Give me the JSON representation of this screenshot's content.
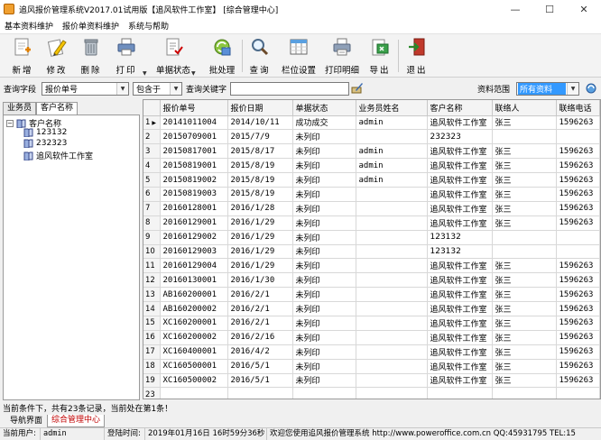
{
  "window": {
    "title": "追风报价管理系统V2017.01试用版【追风软件工作室】 [综合管理中心]",
    "min_label": "—",
    "max_label": "☐",
    "close_label": "✕"
  },
  "menu": [
    "基本资料维护",
    "报价单资料维护",
    "系统与帮助"
  ],
  "toolbar": {
    "new": "新增",
    "edit": "修改",
    "delete": "删除",
    "print": "打印",
    "status": "单据状态",
    "batch": "批处理",
    "query": "查询",
    "columns": "栏位设置",
    "print_detail": "打印明细",
    "export": "导出",
    "exit": "退出"
  },
  "query": {
    "field_label": "查询字段",
    "field_value": "报价单号",
    "op_value": "包含于",
    "keyword_label": "查询关键字",
    "keyword_value": "",
    "scope_label": "资料范围",
    "scope_value": "所有资料"
  },
  "left_tabs": [
    "业务员",
    "客户名称"
  ],
  "tree": {
    "root": "客户名称",
    "children": [
      "123132",
      "232323",
      "追风软件工作室"
    ]
  },
  "grid": {
    "columns": [
      "报价单号",
      "报价日期",
      "单据状态",
      "业务员姓名",
      "客户名称",
      "联络人",
      "联络电话"
    ],
    "rows": [
      [
        "20141011004",
        "2014/10/11",
        "成功成交",
        "admin",
        "追风软件工作室",
        "张三",
        "1596263"
      ],
      [
        "20150709001",
        "2015/7/9",
        "未列印",
        "",
        "232323",
        "",
        ""
      ],
      [
        "20150817001",
        "2015/8/17",
        "未列印",
        "admin",
        "追风软件工作室",
        "张三",
        "1596263"
      ],
      [
        "20150819001",
        "2015/8/19",
        "未列印",
        "admin",
        "追风软件工作室",
        "张三",
        "1596263"
      ],
      [
        "20150819002",
        "2015/8/19",
        "未列印",
        "admin",
        "追风软件工作室",
        "张三",
        "1596263"
      ],
      [
        "20150819003",
        "2015/8/19",
        "未列印",
        "",
        "追风软件工作室",
        "张三",
        "1596263"
      ],
      [
        "20160128001",
        "2016/1/28",
        "未列印",
        "",
        "追风软件工作室",
        "张三",
        "1596263"
      ],
      [
        "20160129001",
        "2016/1/29",
        "未列印",
        "",
        "追风软件工作室",
        "张三",
        "1596263"
      ],
      [
        "20160129002",
        "2016/1/29",
        "未列印",
        "",
        "123132",
        "",
        ""
      ],
      [
        "20160129003",
        "2016/1/29",
        "未列印",
        "",
        "123132",
        "",
        ""
      ],
      [
        "20160129004",
        "2016/1/29",
        "未列印",
        "",
        "追风软件工作室",
        "张三",
        "1596263"
      ],
      [
        "20160130001",
        "2016/1/30",
        "未列印",
        "",
        "追风软件工作室",
        "张三",
        "1596263"
      ],
      [
        "AB160200001",
        "2016/2/1",
        "未列印",
        "",
        "追风软件工作室",
        "张三",
        "1596263"
      ],
      [
        "AB160200002",
        "2016/2/1",
        "未列印",
        "",
        "追风软件工作室",
        "张三",
        "1596263"
      ],
      [
        "XC160200001",
        "2016/2/1",
        "未列印",
        "",
        "追风软件工作室",
        "张三",
        "1596263"
      ],
      [
        "XC160200002",
        "2016/2/16",
        "未列印",
        "",
        "追风软件工作室",
        "张三",
        "1596263"
      ],
      [
        "XC160400001",
        "2016/4/2",
        "未列印",
        "",
        "追风软件工作室",
        "张三",
        "1596263"
      ],
      [
        "XC160500001",
        "2016/5/1",
        "未列印",
        "",
        "追风软件工作室",
        "张三",
        "1596263"
      ],
      [
        "XC160500002",
        "2016/5/1",
        "未列印",
        "",
        "追风软件工作室",
        "张三",
        "1596263"
      ]
    ],
    "last_row_number": "23"
  },
  "status_message": "当前条件下，共有23条记录，当前处在第1条！",
  "bottom_tabs": [
    "导航界面",
    "综合管理中心"
  ],
  "statusbar": {
    "user_label": "当前用户:",
    "user": "admin",
    "login_label": "登陆时间:",
    "login_time": "2019年01月16日 16时59分36秒",
    "welcome": "欢迎您使用追风报价管理系统 http://www.poweroffice.com.cn QQ:45931795 TEL:15"
  }
}
